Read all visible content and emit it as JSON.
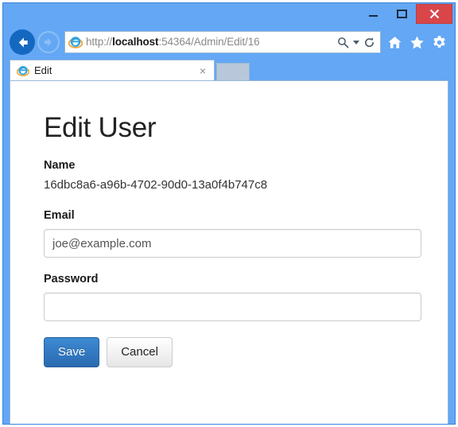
{
  "window": {
    "controls": {
      "minimize_label": "Minimize",
      "maximize_label": "Maximize",
      "close_label": "×"
    },
    "frame_color": "#63a7f5",
    "close_button_color": "#d9464a"
  },
  "browser": {
    "back_label": "Back",
    "forward_label": "Forward",
    "address": {
      "scheme": "http://",
      "host": "localhost",
      "rest": ":54364/Admin/Edit/16",
      "full_url": "http://localhost:54364/Admin/Edit/16",
      "search_icon": "search-icon",
      "dropdown_icon": "chevron-down-icon",
      "refresh_icon": "refresh-icon"
    },
    "toolbar_icons": [
      {
        "name": "home-icon",
        "label": "Home"
      },
      {
        "name": "favorites-star-icon",
        "label": "Favorites"
      },
      {
        "name": "settings-gear-icon",
        "label": "Tools"
      }
    ],
    "tabs": [
      {
        "title": "Edit",
        "close_label": "×",
        "favicon": "ie-favicon"
      }
    ],
    "new_tab_label": ""
  },
  "page": {
    "title": "Edit User",
    "fields": {
      "name": {
        "label": "Name",
        "value": "16dbc8a6-a96b-4702-90d0-13a0f4b747c8"
      },
      "email": {
        "label": "Email",
        "value": "joe@example.com",
        "placeholder": ""
      },
      "password": {
        "label": "Password",
        "value": "",
        "placeholder": ""
      }
    },
    "buttons": {
      "save_label": "Save",
      "cancel_label": "Cancel",
      "primary_color": "#2a6ab0"
    }
  }
}
